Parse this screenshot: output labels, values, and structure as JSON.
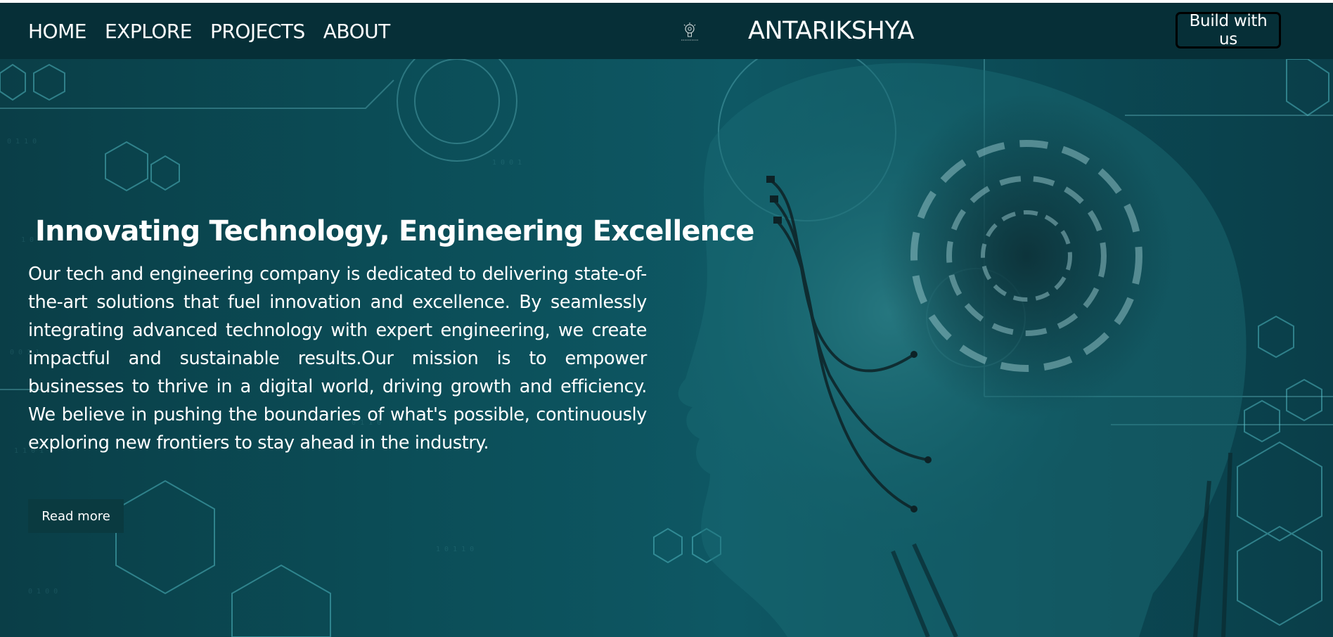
{
  "nav": {
    "links": [
      {
        "label": "HOME"
      },
      {
        "label": "EXPLORE"
      },
      {
        "label": "PROJECTS"
      },
      {
        "label": "ABOUT"
      }
    ],
    "brand": "ANTARIKSHYA",
    "logo_icon": "lightbulb-logo-icon",
    "cta_label": "Build with us"
  },
  "hero": {
    "title": "Innovating Technology, Engineering Excellence",
    "description": "Our tech and engineering company is dedicated to delivering state-of-the-art solutions that fuel innovation and excellence. By seamlessly integrating advanced technology with expert engineering, we create impactful and sustainable results.Our mission is to empower businesses to thrive in a digital world, driving growth and efficiency. We believe in pushing the boundaries of what's possible, continuously exploring new frontiers to stay ahead in the industry.",
    "read_more_label": "Read more",
    "background_image": "ai-robot-head-circuit-background"
  },
  "colors": {
    "navbar_bg": "#062f37",
    "hero_teal": "#0b4d57",
    "text": "#ffffff",
    "button_dark": "#0a3a40"
  }
}
